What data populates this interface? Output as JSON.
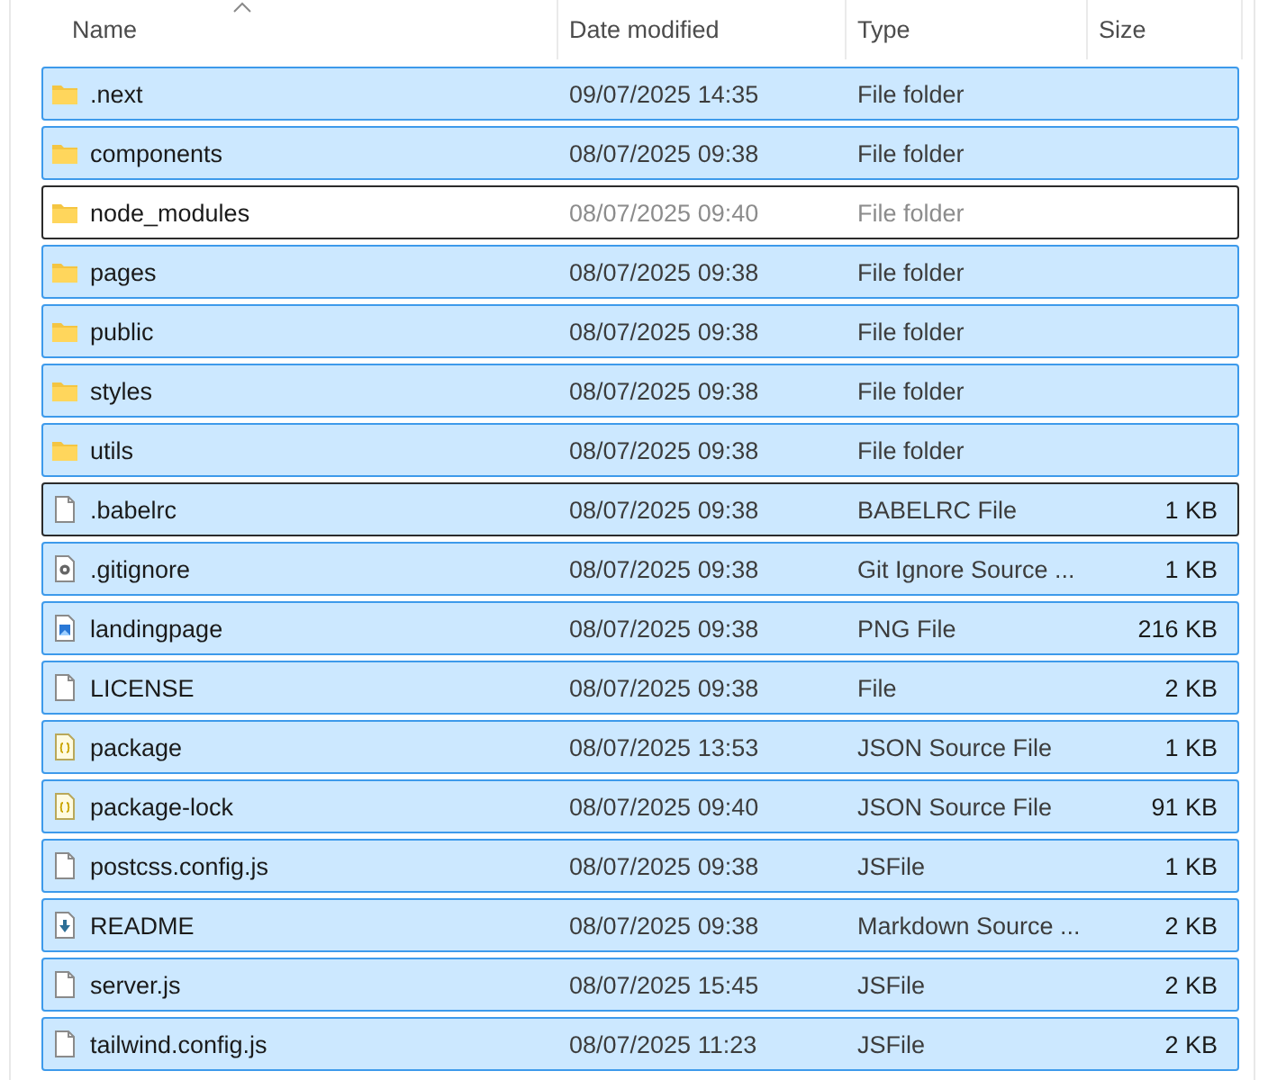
{
  "columns": [
    {
      "label": "Name",
      "sorted": true
    },
    {
      "label": "Date modified",
      "sorted": false
    },
    {
      "label": "Type",
      "sorted": false
    },
    {
      "label": "Size",
      "sorted": false
    }
  ],
  "rows": [
    {
      "kind": "folder",
      "name": ".next",
      "date": "09/07/2025 14:35",
      "type": "File folder",
      "selected": true,
      "focused": false
    },
    {
      "kind": "folder",
      "name": "components",
      "date": "08/07/2025 09:38",
      "type": "File folder",
      "selected": true,
      "focused": false
    },
    {
      "kind": "folder",
      "name": "node_modules",
      "date": "08/07/2025 09:40",
      "type": "File folder",
      "selected": false,
      "focused": true
    },
    {
      "kind": "folder",
      "name": "pages",
      "date": "08/07/2025 09:38",
      "type": "File folder",
      "selected": true,
      "focused": false
    },
    {
      "kind": "folder",
      "name": "public",
      "date": "08/07/2025 09:38",
      "type": "File folder",
      "selected": true,
      "focused": false
    },
    {
      "kind": "folder",
      "name": "styles",
      "date": "08/07/2025 09:38",
      "type": "File folder",
      "selected": true,
      "focused": false
    },
    {
      "kind": "folder",
      "name": "utils",
      "date": "08/07/2025 09:38",
      "type": "File folder",
      "selected": true,
      "focused": false
    },
    {
      "kind": "file",
      "name": ".babelrc",
      "date": "08/07/2025 09:38",
      "type": "BABELRC File",
      "size": "1 KB",
      "selected": true,
      "focused": true
    },
    {
      "kind": "settings",
      "name": ".gitignore",
      "date": "08/07/2025 09:38",
      "type": "Git Ignore Source ...",
      "size": "1 KB",
      "selected": true,
      "focused": false
    },
    {
      "kind": "image",
      "name": "landingpage",
      "date": "08/07/2025 09:38",
      "type": "PNG File",
      "size": "216 KB",
      "selected": true,
      "focused": false
    },
    {
      "kind": "file",
      "name": "LICENSE",
      "date": "08/07/2025 09:38",
      "type": "File",
      "size": "2 KB",
      "selected": true,
      "focused": false
    },
    {
      "kind": "json",
      "name": "package",
      "date": "08/07/2025 13:53",
      "type": "JSON Source File",
      "size": "1 KB",
      "selected": true,
      "focused": false
    },
    {
      "kind": "json",
      "name": "package-lock",
      "date": "08/07/2025 09:40",
      "type": "JSON Source File",
      "size": "91 KB",
      "selected": true,
      "focused": false
    },
    {
      "kind": "file",
      "name": "postcss.config.js",
      "date": "08/07/2025 09:38",
      "type": "JSFile",
      "size": "1 KB",
      "selected": true,
      "focused": false
    },
    {
      "kind": "markdown",
      "name": "README",
      "date": "08/07/2025 09:38",
      "type": "Markdown Source ...",
      "size": "2 KB",
      "selected": true,
      "focused": false
    },
    {
      "kind": "file",
      "name": "server.js",
      "date": "08/07/2025 15:45",
      "type": "JSFile",
      "size": "2 KB",
      "selected": true,
      "focused": false
    },
    {
      "kind": "file",
      "name": "tailwind.config.js",
      "date": "08/07/2025 11:23",
      "type": "JSFile",
      "size": "2 KB",
      "selected": true,
      "focused": false
    }
  ]
}
